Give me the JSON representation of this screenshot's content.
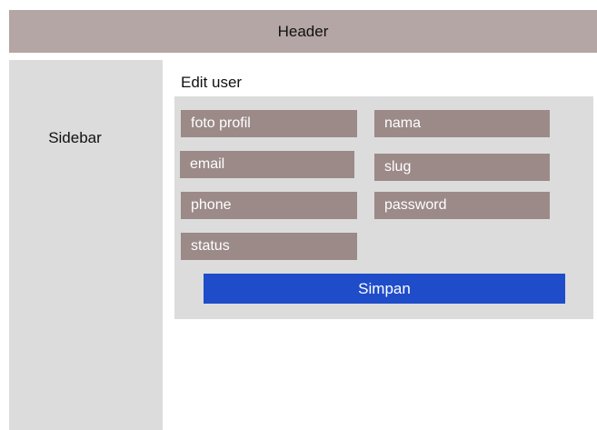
{
  "header": {
    "title": "Header"
  },
  "sidebar": {
    "label": "Sidebar"
  },
  "main": {
    "title": "Edit user",
    "fields": {
      "foto_profil": "foto profil",
      "nama": "nama",
      "email": "email",
      "slug": "slug",
      "phone": "phone",
      "password": "password",
      "status": "status"
    },
    "submit_label": "Simpan"
  },
  "colors": {
    "header_bg": "#b4a6a4",
    "panel_bg": "#dcdcdc",
    "field_bg": "#9b8a88",
    "button_bg": "#1f4cc9"
  }
}
